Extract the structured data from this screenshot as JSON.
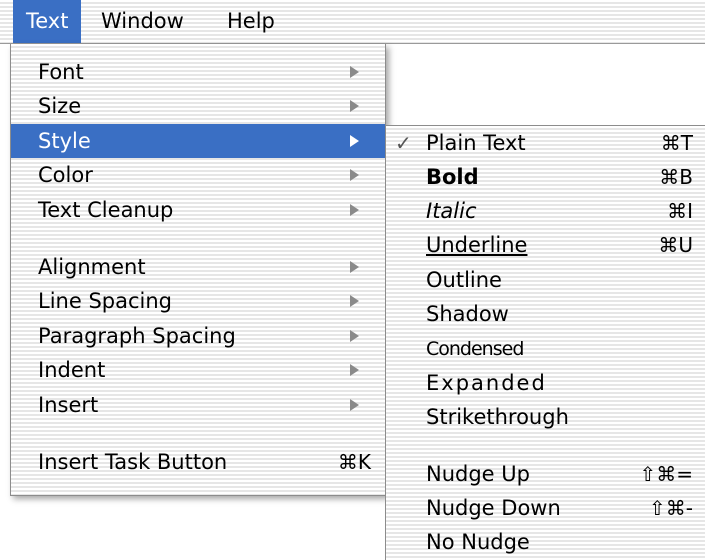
{
  "menubar": {
    "items": [
      {
        "label": "Text",
        "active": true
      },
      {
        "label": "Window",
        "active": false
      },
      {
        "label": "Help",
        "active": false
      }
    ]
  },
  "text_menu": {
    "items": [
      {
        "label": "Font",
        "submenu": true
      },
      {
        "label": "Size",
        "submenu": true
      },
      {
        "label": "Style",
        "submenu": true,
        "selected": true
      },
      {
        "label": "Color",
        "submenu": true
      },
      {
        "label": "Text Cleanup",
        "submenu": true
      },
      {
        "label": "Alignment",
        "submenu": true
      },
      {
        "label": "Line Spacing",
        "submenu": true
      },
      {
        "label": "Paragraph Spacing",
        "submenu": true
      },
      {
        "label": "Indent",
        "submenu": true
      },
      {
        "label": "Insert",
        "submenu": true
      },
      {
        "label": "Insert Task Button",
        "shortcut": "⌘K"
      }
    ]
  },
  "style_submenu": {
    "items": [
      {
        "label": "Plain Text",
        "shortcut": "⌘T",
        "checked": true,
        "check": "✓"
      },
      {
        "label": "Bold",
        "shortcut": "⌘B"
      },
      {
        "label": "Italic",
        "shortcut": "⌘I"
      },
      {
        "label": "Underline",
        "shortcut": "⌘U"
      },
      {
        "label": "Outline"
      },
      {
        "label": "Shadow"
      },
      {
        "label": "Condensed"
      },
      {
        "label": "Expanded"
      },
      {
        "label": "Strikethrough"
      },
      {
        "label": "Nudge Up",
        "shortcut": "⇧⌘="
      },
      {
        "label": "Nudge Down",
        "shortcut": "⇧⌘-"
      },
      {
        "label": "No Nudge"
      }
    ]
  },
  "colors": {
    "highlight": "#3a6fc4",
    "highlight_text": "#ffffff",
    "arrow": "#8a8a8a"
  }
}
